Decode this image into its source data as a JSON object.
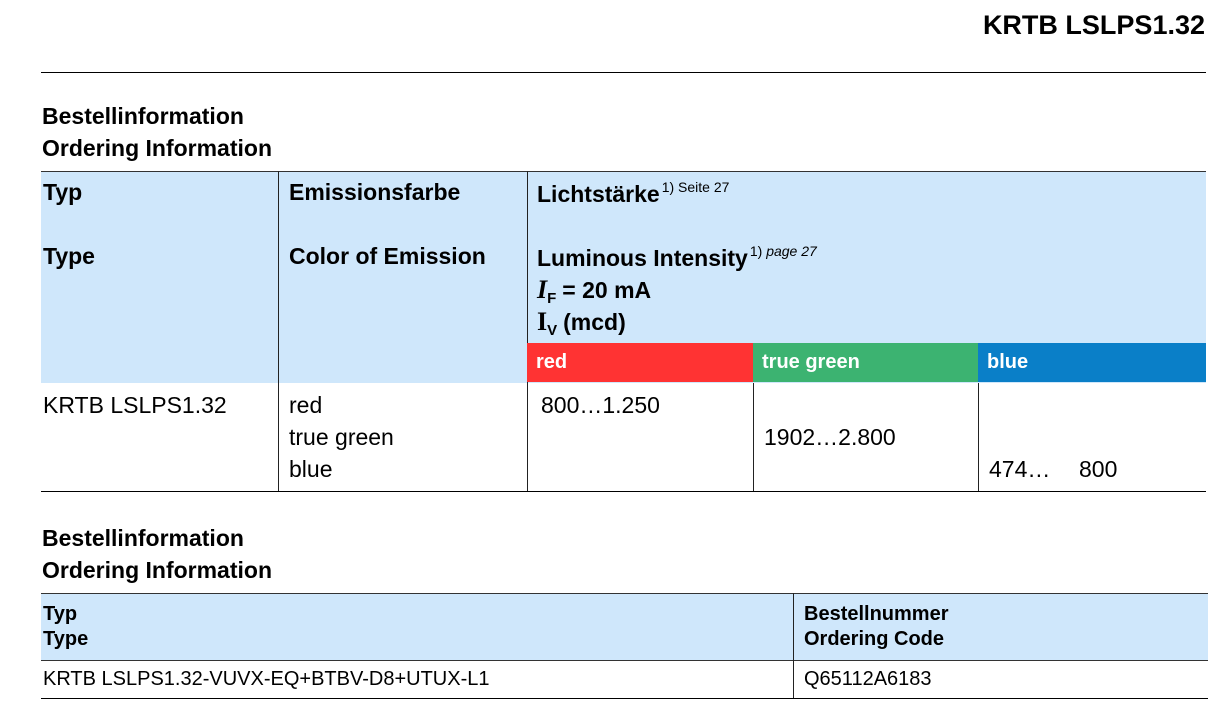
{
  "document": {
    "title": "KRTB LSLPS1.32"
  },
  "section1": {
    "heading_de": "Bestellinformation",
    "heading_en": "Ordering Information",
    "headers": {
      "type_de": "Typ",
      "type_en": "Type",
      "emission_de": "Emissionsfarbe",
      "emission_en": "Color of Emission",
      "intensity_de": "Lichtstärke",
      "intensity_de_note": "1) Seite 27",
      "intensity_en": "Luminous Intensity",
      "intensity_en_note_num": "1)",
      "intensity_en_note_page": "page 27",
      "if_symbol": "I",
      "if_sub": "F",
      "if_value": "= 20 mA",
      "iv_symbol": "I",
      "iv_sub": "V",
      "iv_unit": "(mcd)"
    },
    "color_columns": [
      {
        "label": "red",
        "color": "#ff3333"
      },
      {
        "label": "true green",
        "color": "#3cb371"
      },
      {
        "label": "blue",
        "color": "#0a7fc8"
      }
    ],
    "row": {
      "type": "KRTB LSLPS1.32",
      "colors": [
        "red",
        "true green",
        "blue"
      ],
      "red_value": "800…1.250",
      "green_value": "1902…2.800",
      "blue_value_min": "474…",
      "blue_value_max": "800"
    }
  },
  "section2": {
    "heading_de": "Bestellinformation",
    "heading_en": "Ordering Information",
    "headers": {
      "type_de": "Typ",
      "type_en": "Type",
      "code_de": "Bestellnummer",
      "code_en": "Ordering Code"
    },
    "row": {
      "type": "KRTB LSLPS1.32-VUVX-EQ+BTBV-D8+UTUX-L1",
      "code": "Q65112A6183"
    }
  }
}
